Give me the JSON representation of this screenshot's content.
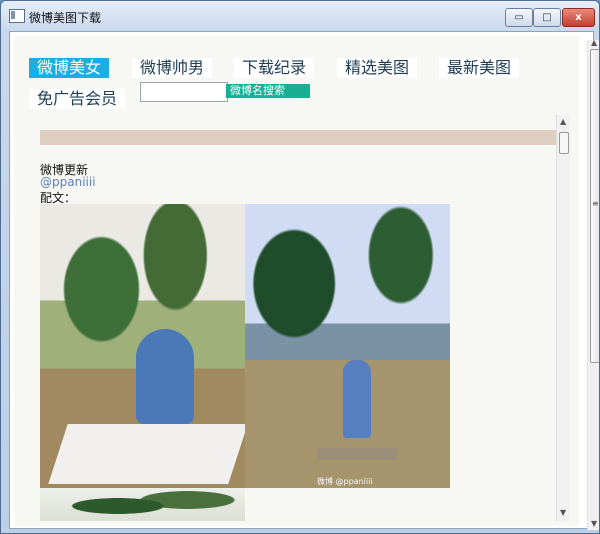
{
  "window": {
    "title": "微博美图下载",
    "controls": {
      "minimize": "▭",
      "maximize": "□",
      "close": "x"
    }
  },
  "nav": {
    "items": [
      {
        "label": "微博美女",
        "active": true
      },
      {
        "label": "微博帅男",
        "active": false
      },
      {
        "label": "下载纪录",
        "active": false
      },
      {
        "label": "精选美图",
        "active": false
      },
      {
        "label": "最新美图",
        "active": false
      },
      {
        "label": "免广告会员",
        "active": false
      }
    ]
  },
  "search": {
    "value": "",
    "button": "微博名搜索"
  },
  "post": {
    "heading": "微博更新",
    "username": "@ppaniiii",
    "caption_label": "配文："
  },
  "images": {
    "watermark1": "微博 @ppaniiii",
    "watermark2": "微博 @ppaniiii"
  },
  "scroll": {
    "up": "▲",
    "down": "▼",
    "thumb_mark": "≡"
  }
}
